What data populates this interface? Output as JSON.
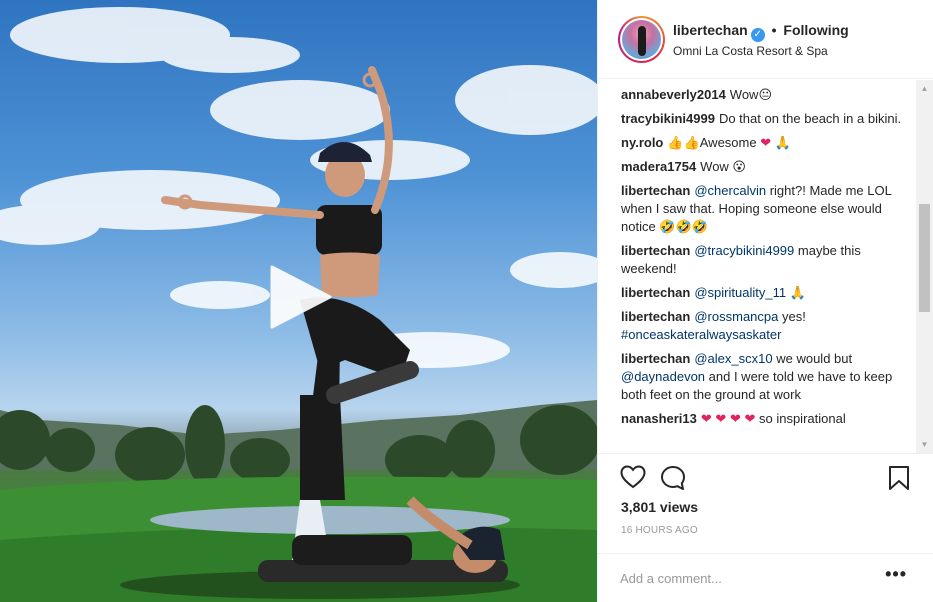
{
  "post": {
    "username": "libertechan",
    "verified": true,
    "separator": "•",
    "follow_label": "Following",
    "location": "Omni La Costa Resort & Spa"
  },
  "comments": [
    {
      "user": "annabeverly2014",
      "text": "Wow😐"
    },
    {
      "user": "tracybikini4999",
      "text": "Do that on the beach in a bikini."
    },
    {
      "user": "ny.rolo",
      "text": "👍👍Awesome ❤ 🙏"
    },
    {
      "user": "madera1754",
      "text": "Wow 😮"
    },
    {
      "user": "libertechan",
      "mention": "@chercalvin",
      "text": " right?! Made me LOL when I saw that. Hoping someone else would notice 🤣🤣🤣"
    },
    {
      "user": "libertechan",
      "mention": "@tracybikini4999",
      "text": " maybe this weekend!"
    },
    {
      "user": "libertechan",
      "mention": "@spirituality_11",
      "text": " 🙏"
    },
    {
      "user": "libertechan",
      "mention": "@rossmancpa",
      "text": " yes! ",
      "hashtag": "#onceaskateralwaysaskater"
    },
    {
      "user": "libertechan",
      "mention": "@alex_scx10",
      "text": " we would but ",
      "mention2": "@daynadevon",
      "text2": " and I were told we have to keep both feet on the ground at work"
    },
    {
      "user": "nanasheri13",
      "text": "❤ ❤ ❤ ❤  so inspirational"
    }
  ],
  "stats": {
    "views": "3,801 views",
    "timestamp": "16 HOURS AGO"
  },
  "composer": {
    "placeholder": "Add a comment...",
    "more_label": "•••"
  },
  "icons": {
    "like": "heart-icon",
    "comment": "comment-icon",
    "save": "bookmark-icon",
    "play": "play-icon",
    "verified": "verified-badge-icon"
  },
  "colors": {
    "mention": "#003569",
    "verified": "#3897f0",
    "heart_emoji": "#e0245e"
  }
}
